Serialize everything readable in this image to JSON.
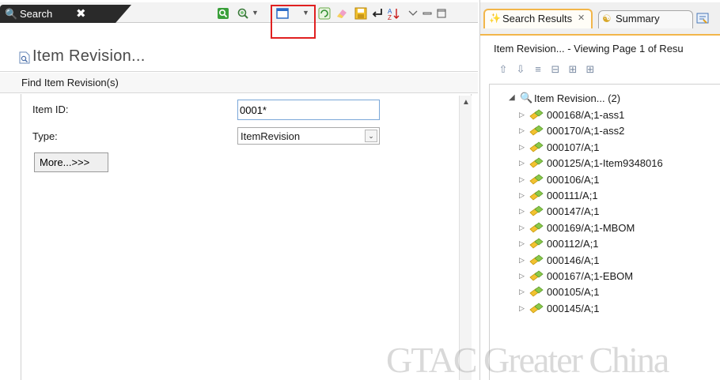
{
  "search_view": {
    "tab_label": "Search",
    "form_title": "Item Revision...",
    "section_label": "Find Item Revision(s)",
    "fields": {
      "item_id_label": "Item ID:",
      "item_id_value": "0001*",
      "type_label": "Type:",
      "type_value": "ItemRevision"
    },
    "more_button_label": "More...>>>"
  },
  "results_view": {
    "tab_label": "Search Results",
    "tab_close": "✕",
    "summary_tab_label": "Summary",
    "viewing_text": "Item Revision... - Viewing Page 1 of Resu",
    "tree_root_label": "Item Revision... (2)",
    "items": [
      "000168/A;1-ass1",
      "000170/A;1-ass2",
      "000107/A;1",
      "000125/A;1-Item9348016",
      "000106/A;1",
      "000111/A;1",
      "000147/A;1",
      "000169/A;1-MBOM",
      "000112/A;1",
      "000146/A;1",
      "000167/A;1-EBOM",
      "000105/A;1",
      "000145/A;1"
    ]
  },
  "watermark_text": "GTAC Greater China",
  "colors": {
    "search_tab_bg": "#2a2a2a",
    "results_tab_border": "#f2b64a",
    "highlight_box": "#e02020",
    "input_border": "#7aa7d8"
  },
  "icons": {
    "search_tab": "magnifier-icon",
    "results_tab": "wand-icon",
    "summary_tab": "summary-icon",
    "tree_item": "item-revision-icon"
  }
}
